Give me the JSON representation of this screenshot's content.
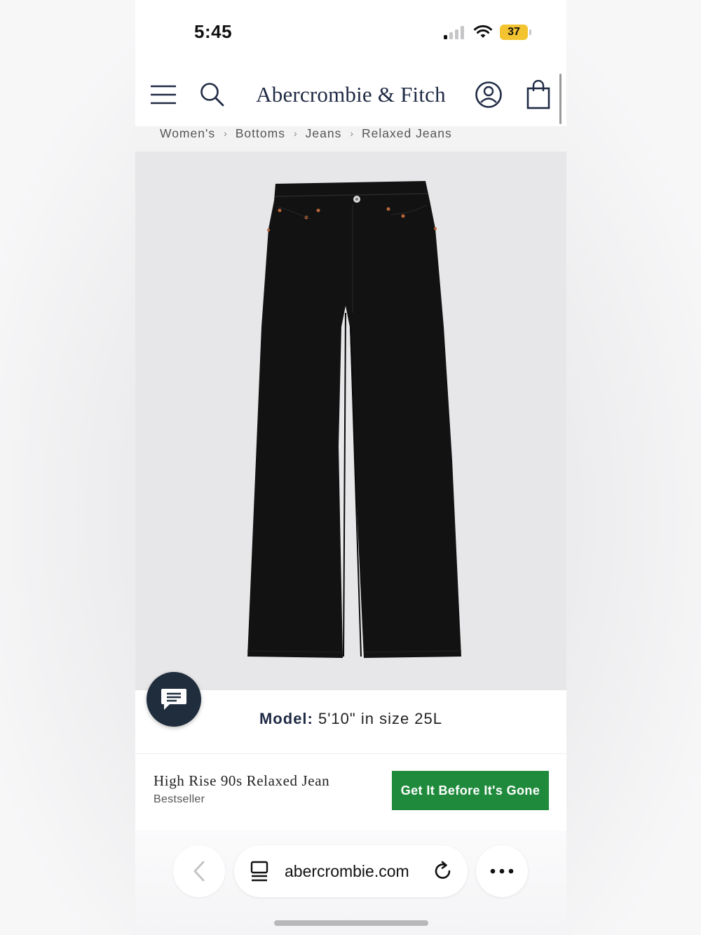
{
  "status_bar": {
    "time": "5:45",
    "battery_level": "37",
    "battery_color": "#f4c430"
  },
  "header": {
    "brand": "Abercrombie & Fitch",
    "icons": [
      "menu-icon",
      "search-icon",
      "account-icon",
      "shopping-bag-icon"
    ],
    "brand_color": "#1f2a44"
  },
  "breadcrumb": {
    "items": [
      "Women's",
      "Bottoms",
      "Jeans",
      "Relaxed Jeans"
    ]
  },
  "product": {
    "image": "black-high-rise-relaxed-jeans",
    "model_label": "Model:",
    "model_info": "5'10\" in size 25L",
    "title": "High Rise 90s Relaxed Jean",
    "badge": "Bestseller",
    "cta_label": "Get It Before It's Gone",
    "cta_color": "#1f8a3c"
  },
  "chat": {
    "icon": "chat-icon"
  },
  "browser": {
    "url": "abercrombie.com",
    "icons": [
      "back-icon",
      "tab-icon",
      "reload-icon",
      "more-icon"
    ]
  }
}
